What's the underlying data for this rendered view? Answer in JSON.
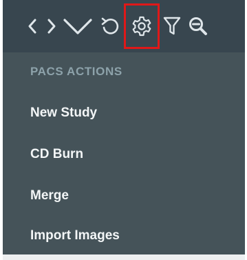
{
  "toolbar": {
    "buttons": [
      {
        "icon": "chevron-left-icon"
      },
      {
        "icon": "chevron-right-icon"
      },
      {
        "icon": "chevron-down-icon"
      },
      {
        "icon": "undo-icon"
      },
      {
        "icon": "gear-icon",
        "highlighted": true
      },
      {
        "icon": "filter-icon"
      },
      {
        "icon": "zoom-out-icon"
      }
    ],
    "icon_color": "#dfe6ea",
    "highlight_color": "#e01818"
  },
  "menu": {
    "header": "PACS ACTIONS",
    "items": [
      {
        "label": "New Study"
      },
      {
        "label": "CD Burn"
      },
      {
        "label": "Merge"
      },
      {
        "label": "Import Images"
      }
    ]
  },
  "colors": {
    "toolbar_bg": "#38464f",
    "menu_bg": "#455359",
    "header_text": "#8da2aa",
    "item_text": "#f3f6f7"
  }
}
